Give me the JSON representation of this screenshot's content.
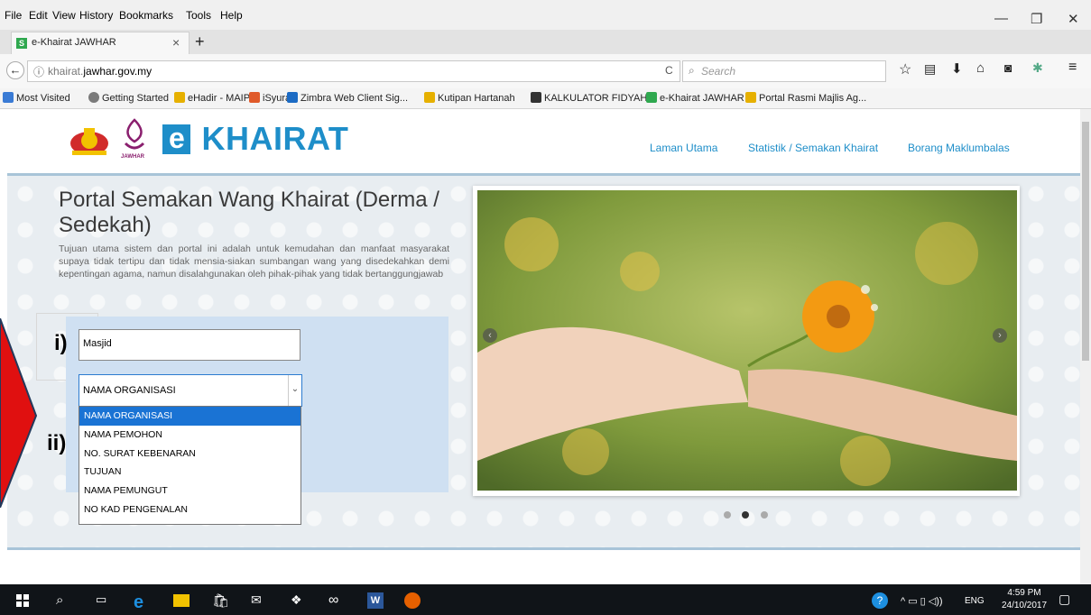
{
  "browser": {
    "menu": [
      "File",
      "Edit",
      "View",
      "History",
      "Bookmarks",
      "Tools",
      "Help"
    ],
    "menu_underlines": [
      "F",
      "E",
      "V",
      "s",
      "B",
      "T",
      "H"
    ],
    "tab_title": "e-Khairat JAWHAR",
    "tab_close": "×",
    "new_tab": "+",
    "url_prefix": "ⓘ",
    "url_host": "khairat.",
    "url_domain": "jawhar.gov.my",
    "reload": "C",
    "search_placeholder": "Search",
    "bookmarks": [
      {
        "label": "Most Visited",
        "color": "#3a7bd5"
      },
      {
        "label": "Getting Started",
        "color": "#7a7a7a"
      },
      {
        "label": "eHadir - MAIPk",
        "color": "#e6b000"
      },
      {
        "label": "iSyura",
        "color": "#e05a2a"
      },
      {
        "label": "Zimbra Web Client Sig...",
        "color": "#1c6bc4"
      },
      {
        "label": "Kutipan Hartanah",
        "color": "#e6b000"
      },
      {
        "label": "KALKULATOR FIDYAH",
        "color": "#333333"
      },
      {
        "label": "e-Khairat JAWHAR",
        "color": "#2fa84f"
      },
      {
        "label": "Portal Rasmi Majlis Ag...",
        "color": "#e6b000"
      }
    ]
  },
  "site": {
    "logo_text": "e- KHAIRAT",
    "logo_small": "JAWHAR",
    "nav": [
      "Laman Utama",
      "Statistik / Semakan Khairat",
      "Borang Maklumbalas"
    ],
    "title": "Portal Semakan Wang Khairat (Derma / Sedekah)",
    "description": "Tujuan utama sistem dan portal ini adalah untuk kemudahan dan manfaat masyarakat supaya tidak tertipu dan tidak mensia-siakan sumbangan wang yang disedekahkan demi kepentingan agama, namun disalahgunakan oleh pihak-pihak yang tidak bertanggungjawab",
    "search_value": "Masjid",
    "select_value": "NAMA ORGANISASI",
    "options": [
      "NAMA ORGANISASI",
      "NAMA PEMOHON",
      "NO. SURAT KEBENARAN",
      "TUJUAN",
      "NAMA PEMUNGUT",
      "NO KAD PENGENALAN"
    ],
    "annotation_i": "i)",
    "annotation_ii": "ii)",
    "accent_color": "#1e8ec9",
    "carousel_active": 2,
    "carousel_count": 3
  },
  "taskbar": {
    "time": "4:59 PM",
    "date": "24/10/2017",
    "lang": "ENG"
  }
}
